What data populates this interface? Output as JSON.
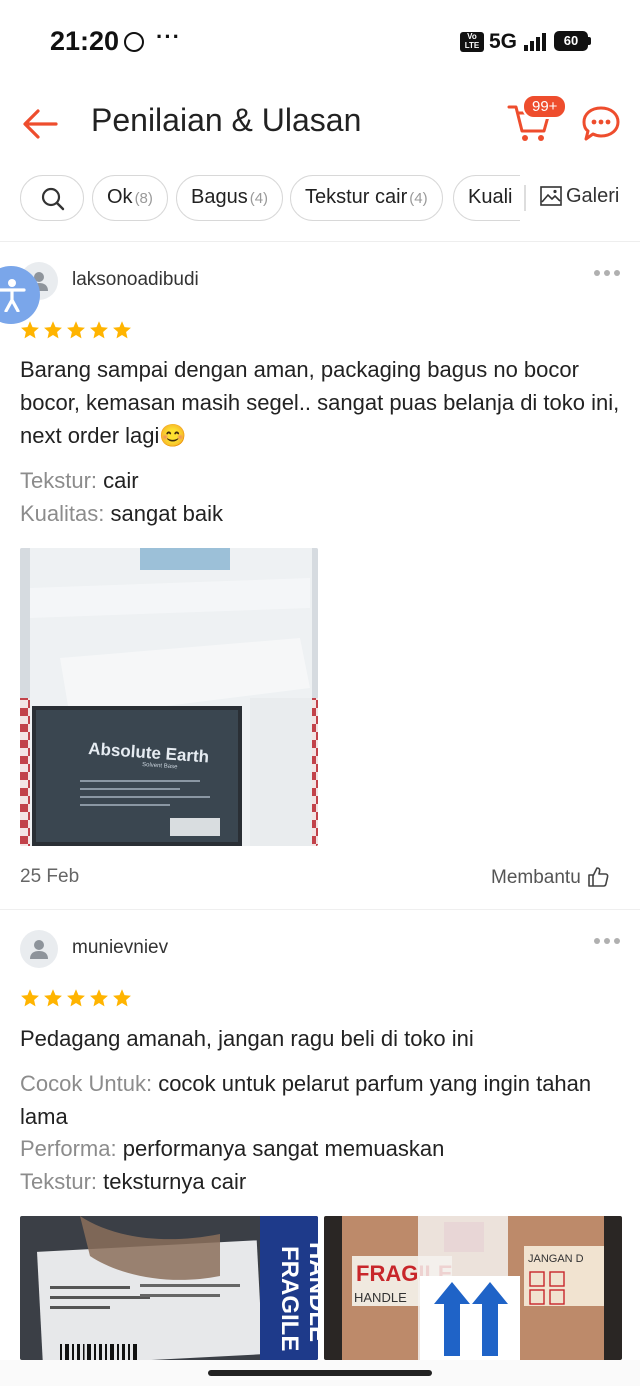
{
  "status_bar": {
    "time": "21:20",
    "dots": "···",
    "volte": "Vo LTE",
    "network": "5G",
    "battery": "60"
  },
  "header": {
    "title": "Penilaian & Ulasan",
    "cart_badge": "99+",
    "accent_color": "#ee4d2d"
  },
  "filters": {
    "chips": [
      {
        "label": "Ok",
        "count": "(8)"
      },
      {
        "label": "Bagus",
        "count": "(4)"
      },
      {
        "label": "Tekstur cair",
        "count": "(4)"
      },
      {
        "label": "Kuali",
        "count": ""
      }
    ],
    "gallery_label": "Galeri"
  },
  "reviews": [
    {
      "username": "laksonoadibudi",
      "rating": 5,
      "text": "Barang sampai dengan aman, packaging bagus no bocor bocor, kemasan masih segel.. sangat puas belanja di toko ini, next order lagi😊",
      "attributes": [
        {
          "key": "Tekstur:",
          "value": "cair"
        },
        {
          "key": "Kualitas:",
          "value": "sangat baik"
        }
      ],
      "photo_label": {
        "brand": "Absolute Earth",
        "sub": "Solvent Base"
      },
      "date": "25 Feb",
      "helpful_label": "Membantu"
    },
    {
      "username": "munievniev",
      "rating": 5,
      "text": "Pedagang amanah, jangan ragu beli di toko ini",
      "attributes": [
        {
          "key": "Cocok Untuk:",
          "value": "cocok untuk pelarut parfum yang ingin tahan lama"
        },
        {
          "key": "Performa:",
          "value": "performanya sangat memuaskan"
        },
        {
          "key": "Tekstur:",
          "value": "teksturnya cair"
        }
      ],
      "photo_labels": {
        "fragile": "FRAGILE",
        "handle": "HANDLE",
        "jangan": "JANGAN D"
      }
    }
  ]
}
